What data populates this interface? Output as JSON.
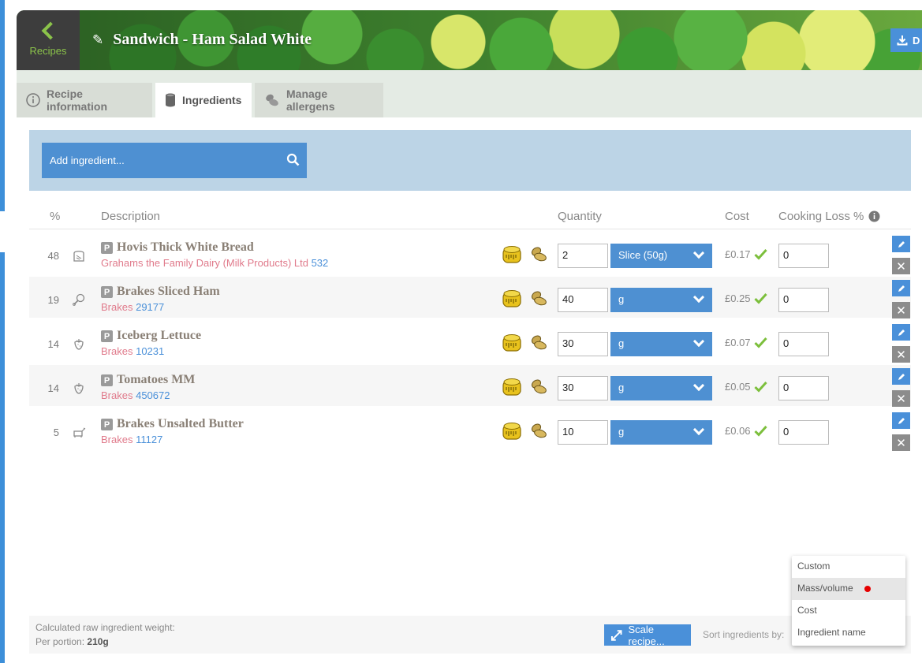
{
  "header": {
    "back_label": "Recipes",
    "title": "Sandwich - Ham Salad White",
    "download_label": "D"
  },
  "tabs": [
    {
      "label": "Recipe information",
      "icon": "info-icon",
      "active": false
    },
    {
      "label": "Ingredients",
      "icon": "ingredients-can-icon",
      "active": true
    },
    {
      "label": "Manage allergens",
      "icon": "allergen-nuts-icon",
      "active": false
    }
  ],
  "add_ingredient": {
    "placeholder": "Add ingredient..."
  },
  "columns": {
    "pct": "%",
    "description": "Description",
    "quantity": "Quantity",
    "cost": "Cost",
    "cooking_loss": "Cooking Loss %"
  },
  "ingredients": [
    {
      "pct": "48",
      "category_icon": "bread-icon",
      "name": "Hovis Thick White Bread",
      "supplier": "Grahams the Family Dairy (Milk Products) Ltd",
      "code": "532",
      "qty": "2",
      "unit": "Slice (50g)",
      "cost": "£0.17",
      "loss": "0"
    },
    {
      "pct": "19",
      "category_icon": "meat-drumstick-icon",
      "name": "Brakes Sliced Ham",
      "supplier": "Brakes",
      "code": "29177",
      "qty": "40",
      "unit": "g",
      "cost": "£0.25",
      "loss": "0"
    },
    {
      "pct": "14",
      "category_icon": "strawberry-icon",
      "name": "Iceberg Lettuce",
      "supplier": "Brakes",
      "code": "10231",
      "qty": "30",
      "unit": "g",
      "cost": "£0.07",
      "loss": "0"
    },
    {
      "pct": "14",
      "category_icon": "strawberry-icon",
      "name": "Tomatoes MM",
      "supplier": "Brakes",
      "code": "450672",
      "qty": "30",
      "unit": "g",
      "cost": "£0.05",
      "loss": "0"
    },
    {
      "pct": "5",
      "category_icon": "dairy-cow-icon",
      "name": "Brakes Unsalted Butter",
      "supplier": "Brakes",
      "code": "11127",
      "qty": "10",
      "unit": "g",
      "cost": "£0.06",
      "loss": "0"
    }
  ],
  "row_badge": "P",
  "footer": {
    "weight_label": "Calculated raw ingredient weight:",
    "per_portion_label": "Per portion:",
    "per_portion_value": "210g",
    "scale_label": "Scale recipe...",
    "sort_label": "Sort ingredients by:"
  },
  "sort_options": [
    {
      "label": "Custom",
      "highlighted": false,
      "selected": false
    },
    {
      "label": "Mass/volume",
      "highlighted": true,
      "selected": true
    },
    {
      "label": "Cost",
      "highlighted": false,
      "selected": false
    },
    {
      "label": "Ingredient name",
      "highlighted": false,
      "selected": false
    }
  ],
  "colors": {
    "accent_blue": "#4e90d2",
    "band_blue": "#bcd4e6",
    "check_green": "#7cbf3c",
    "supplier_pink": "#e07a8b",
    "code_blue": "#4a90d9",
    "selected_dot": "#e60000"
  }
}
